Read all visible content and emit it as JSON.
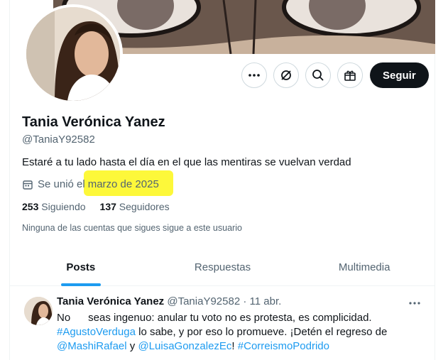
{
  "profile": {
    "name": "Tania Verónica Yanez",
    "handle": "@TaniaY92582",
    "bio": "Estaré a tu lado hasta el día en el que las mentiras se vuelvan verdad",
    "joined_prefix": "Se unió el",
    "joined_date": "marzo de 2025",
    "following_count": "253",
    "following_label": "Siguiendo",
    "followers_count": "137",
    "followers_label": "Seguidores",
    "mutual_note": "Ninguna de las cuentas que sigues sigue a este usuario"
  },
  "actions": {
    "more_icon": "more-icon",
    "grok_icon": "grok-icon",
    "search_icon": "search-icon",
    "gift_icon": "gift-icon",
    "follow_label": "Seguir"
  },
  "tabs": [
    {
      "label": "Posts",
      "active": true
    },
    {
      "label": "Respuestas",
      "active": false
    },
    {
      "label": "Multimedia",
      "active": false
    }
  ],
  "post": {
    "author": "Tania Verónica Yanez",
    "handle": "@TaniaY92582",
    "separator": "·",
    "date": "11 abr.",
    "text_1": "No      seas ingenuo: anular tu voto no es protesta, es complicidad.",
    "hashtag_1": "#AgustoVerduga",
    "text_2": " lo sabe, y por eso lo promueve. ¡Detén el regreso de",
    "mention_1": "@MashiRafael",
    "text_3": " y ",
    "mention_2": "@LuisaGonzalezEc",
    "text_4": "! ",
    "hashtag_2": "#CorreismoPodrido"
  },
  "colors": {
    "accent": "#1d9bf0",
    "highlight": "#fdf83a",
    "text": "#0f1419",
    "muted": "#536471"
  }
}
